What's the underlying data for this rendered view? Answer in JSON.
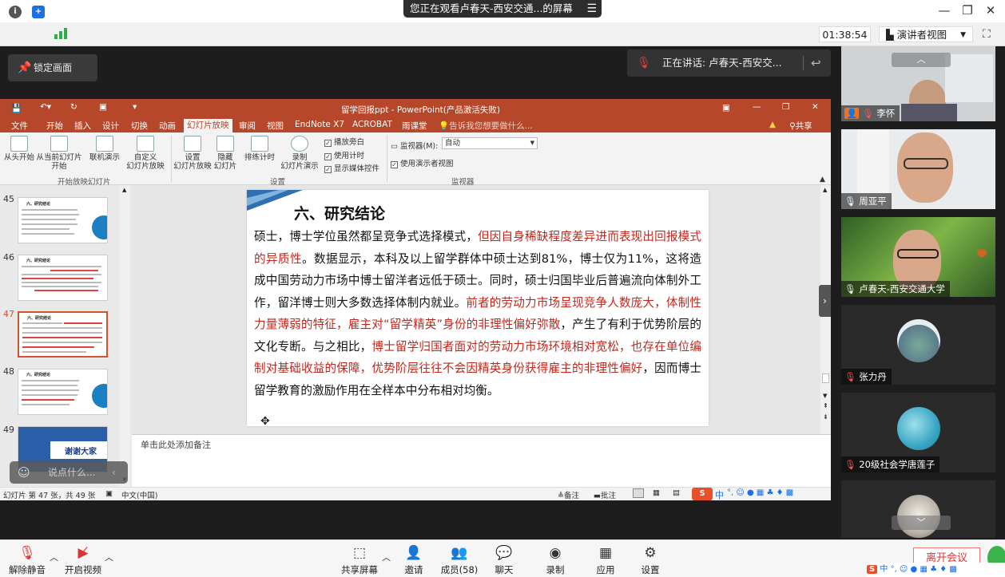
{
  "window": {
    "banner": "您正在观看卢春天-西安交通...的屏幕",
    "banner_menu_icon": "menu-lines-icon",
    "timer": "01:38:54",
    "presenter_view": "演讲者视图"
  },
  "share": {
    "lock_label": "锁定画面",
    "speaking": "正在讲话: 卢春天-西安交..."
  },
  "ppt": {
    "title": "留学回报ppt - PowerPoint(产品激活失败)",
    "tabs": [
      "文件",
      "开始",
      "插入",
      "设计",
      "切换",
      "动画",
      "幻灯片放映",
      "审阅",
      "视图",
      "EndNote X7",
      "ACROBAT",
      "雨课堂"
    ],
    "active_tab": "幻灯片放映",
    "tell_me": "告诉我您想要做什么...",
    "share_label": "共享",
    "ribbon": {
      "from_start": "从头开始",
      "from_current": "从当前幻灯片\n开始",
      "online": "联机演示",
      "custom": "自定义\n幻灯片放映",
      "setup": "设置\n幻灯片放映",
      "hide": "隐藏\n幻灯片",
      "rehearse": "排练计时",
      "record": "录制\n幻灯片演示",
      "chk_narration": "播放旁白",
      "chk_timing": "使用计时",
      "chk_media": "显示媒体控件",
      "monitor_label": "监视器(M):",
      "monitor_value": "自动",
      "chk_presenter": "使用演示者视图",
      "grp_start": "开始放映幻灯片",
      "grp_setup": "设置",
      "grp_monitor": "监视器"
    },
    "thumb_numbers": [
      "45",
      "46",
      "47",
      "48",
      "49"
    ],
    "thumb_titles": [
      "六、研究结论",
      "六、研究结论",
      "六、研究结论",
      "六、研究结论"
    ],
    "thumb_thanks": "谢谢大家",
    "slide": {
      "title": "六、研究结论",
      "p1": "硕士，博士学位虽然都呈竞争式选择模式，",
      "r1": "但因自身稀缺程度差异进而表现出回报模式的异质性",
      "p2": "。数据显示，本科及以上留学群体中硕士达到81%，博士仅为11%，这将造成中国劳动力市场中博士留洋者远低于硕士。同时，硕士归国毕业后普遍流向体制外工作，留洋博士则大多数选择体制内就业。",
      "r2": "前者的劳动力市场呈现竞争人数庞大，体制性力量薄弱的特征，雇主对“留学精英”身份的非理性偏好弥散",
      "p3": "，产生了有利于优势阶层的文化专断。与之相比，",
      "r3": "博士留学归国者面对的劳动力市场环境相对宽松，也存在单位编制对基础收益的保障，优势阶层往往不会因精英身份获得雇主的非理性偏好",
      "p4": "，因而博士留学教育的激励作用在全样本中分布相对均衡。"
    },
    "notes_placeholder": "单击此处添加备注",
    "status_slide": "幻灯片 第 47 张，共 49 张",
    "status_lang": "中文(中国)",
    "status_notes": "备注",
    "status_comments": "批注"
  },
  "chat_placeholder": "说点什么...",
  "participants": [
    {
      "name": "李怀",
      "icon": "mic-muted-icon"
    },
    {
      "name": "周亚平",
      "icon": "mic-icon"
    },
    {
      "name": "卢春天-西安交通大学",
      "icon": "mic-icon"
    },
    {
      "name": "张力丹",
      "icon": "mic-muted-icon"
    },
    {
      "name": "20级社会学唐莲子",
      "icon": "mic-muted-icon"
    }
  ],
  "toolbar": {
    "unmute": "解除静音",
    "video": "开启视频",
    "share": "共享屏幕",
    "invite": "邀请",
    "members": "成员(58)",
    "chat": "聊天",
    "record": "录制",
    "apps": "应用",
    "settings": "设置",
    "leave": "离开会议"
  },
  "ime_char": "中"
}
